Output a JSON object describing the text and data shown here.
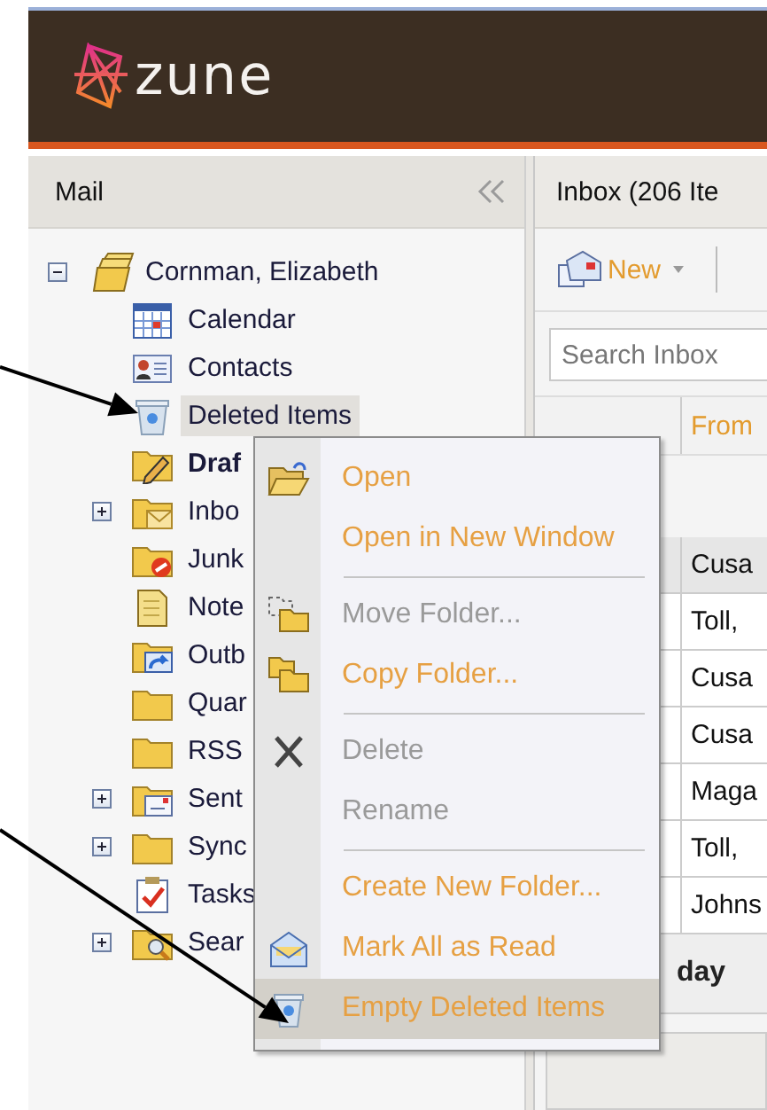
{
  "header": {
    "brand": "zune"
  },
  "mail_pane": {
    "title": "Mail",
    "tree": [
      {
        "label": "Cornman, Elizabeth",
        "kind": "account",
        "expanded": true,
        "selected": false,
        "bold": false,
        "children": [
          {
            "label": "Calendar",
            "kind": "calendar",
            "selected": false,
            "bold": false
          },
          {
            "label": "Contacts",
            "kind": "contacts",
            "selected": false,
            "bold": false
          },
          {
            "label": "Deleted Items",
            "kind": "trash",
            "selected": true,
            "bold": false
          },
          {
            "label": "Draf",
            "kind": "drafts",
            "selected": false,
            "bold": true
          },
          {
            "label": "Inbo",
            "kind": "inbox",
            "expanded": false,
            "selected": false,
            "bold": false
          },
          {
            "label": "Junk",
            "kind": "junk",
            "selected": false,
            "bold": false
          },
          {
            "label": "Note",
            "kind": "notes",
            "selected": false,
            "bold": false
          },
          {
            "label": "Outb",
            "kind": "outbox",
            "selected": false,
            "bold": false
          },
          {
            "label": "Quar",
            "kind": "folder",
            "selected": false,
            "bold": false
          },
          {
            "label": "RSS",
            "kind": "folder",
            "selected": false,
            "bold": false
          },
          {
            "label": "Sent",
            "kind": "sent",
            "expanded": false,
            "selected": false,
            "bold": false
          },
          {
            "label": "Sync",
            "kind": "folder",
            "expanded": false,
            "selected": false,
            "bold": false
          },
          {
            "label": "Tasks",
            "kind": "tasks",
            "selected": false,
            "bold": false
          },
          {
            "label": "Sear",
            "kind": "search",
            "expanded": false,
            "selected": false,
            "bold": false
          }
        ]
      }
    ]
  },
  "inbox_pane": {
    "title": "Inbox (206 Ite",
    "new_label": "New",
    "search": {
      "placeholder": "Search Inbox"
    },
    "columns": [
      "From"
    ],
    "rows": [
      {
        "from": "Cusa",
        "selected": true
      },
      {
        "from": "Toll,",
        "selected": false
      },
      {
        "from": "Cusa",
        "selected": false
      },
      {
        "from": "Cusa",
        "selected": false
      },
      {
        "from": "Maga",
        "selected": false
      },
      {
        "from": "Toll,",
        "selected": false
      },
      {
        "from": "Johns",
        "selected": false
      }
    ],
    "group_header": "day"
  },
  "context_menu": {
    "groups": [
      {
        "items": [
          {
            "label": "Open",
            "kind": "open",
            "disabled": false,
            "selected": false
          },
          {
            "label": "Open in New Window",
            "kind": "none",
            "disabled": false,
            "selected": false
          }
        ]
      },
      {
        "items": [
          {
            "label": "Move Folder...",
            "kind": "move",
            "disabled": true,
            "selected": false
          },
          {
            "label": "Copy Folder...",
            "kind": "copy",
            "disabled": false,
            "selected": false
          }
        ]
      },
      {
        "items": [
          {
            "label": "Delete",
            "kind": "delete",
            "disabled": true,
            "selected": false
          },
          {
            "label": "Rename",
            "kind": "none",
            "disabled": true,
            "selected": false
          }
        ]
      },
      {
        "items": [
          {
            "label": "Create New Folder...",
            "kind": "none",
            "disabled": false,
            "selected": false
          },
          {
            "label": "Mark All as Read",
            "kind": "read",
            "disabled": false,
            "selected": false
          },
          {
            "label": "Empty Deleted Items",
            "kind": "trash",
            "disabled": false,
            "selected": true
          }
        ]
      }
    ]
  }
}
